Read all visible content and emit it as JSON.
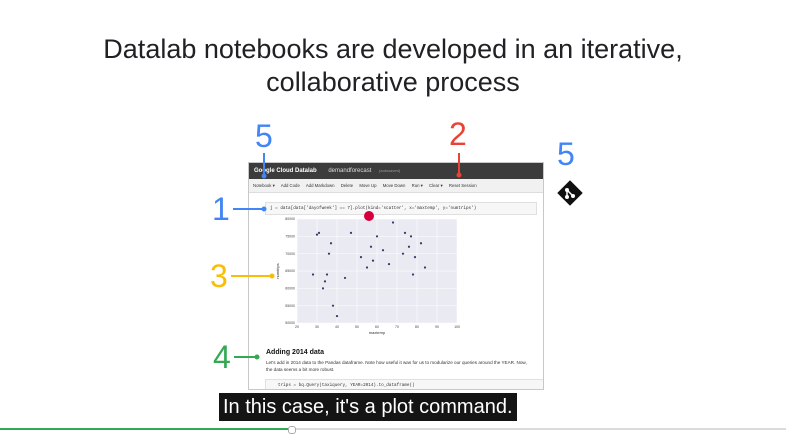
{
  "slide": {
    "title_line1": "Datalab notebooks are developed in an iterative,",
    "title_line2": "collaborative process"
  },
  "callouts": {
    "n5_top": "5",
    "n2": "2",
    "n5_right": "5",
    "n1": "1",
    "n3": "3",
    "n4": "4"
  },
  "colors": {
    "blue": "#4285f4",
    "red": "#ea4335",
    "yellow": "#fbbc04",
    "green": "#34a853"
  },
  "notebook": {
    "brand": "Google Cloud Datalab",
    "name": "demandforecast",
    "status": "(autosaved)",
    "toolbar": [
      "Notebook ▾",
      "Add Code",
      "Add Markdown",
      "Delete",
      "Move Up",
      "Move Down",
      "Run ▾",
      "Clear ▾",
      "Reset Session"
    ],
    "code1": "j = data[data['dayofweek'] == 7].plot(kind='scatter', x='maxtemp', y='numtrips')",
    "markdown_title": "Adding 2014 data",
    "markdown_text": "Let's add in 2014 data to the Pandas dataframe. Note how useful it was for us to modularize our queries around the YEAR. Now, the data seems a bit more robust.",
    "code2": "trips = bq.Query(taxiquery, YEAR=2014).to_dataframe()"
  },
  "chart_data": {
    "type": "scatter",
    "xlabel": "maxtemp",
    "ylabel": "numtrips",
    "xlim": [
      20,
      100
    ],
    "ylim": [
      50000,
      80000
    ],
    "xticks": [
      "20",
      "30",
      "40",
      "50",
      "60",
      "70",
      "80",
      "90",
      "100"
    ],
    "yticks": [
      "50000",
      "55000",
      "60000",
      "65000",
      "70000",
      "75000",
      "80000"
    ],
    "x": [
      28,
      30,
      31,
      33,
      34,
      35,
      36,
      37,
      38,
      40,
      44,
      47,
      52,
      55,
      57,
      58,
      60,
      63,
      66,
      68,
      73,
      74,
      76,
      77,
      78,
      79,
      82,
      84
    ],
    "y": [
      64000,
      75500,
      76000,
      60000,
      62000,
      64000,
      70000,
      73000,
      55000,
      52000,
      63000,
      76000,
      69000,
      66000,
      72000,
      68000,
      75000,
      71000,
      67000,
      79000,
      70000,
      76000,
      72000,
      75000,
      64000,
      69000,
      73000,
      66000
    ]
  },
  "video": {
    "caption": "In this case, it's a plot command.",
    "progress": 0.37
  }
}
